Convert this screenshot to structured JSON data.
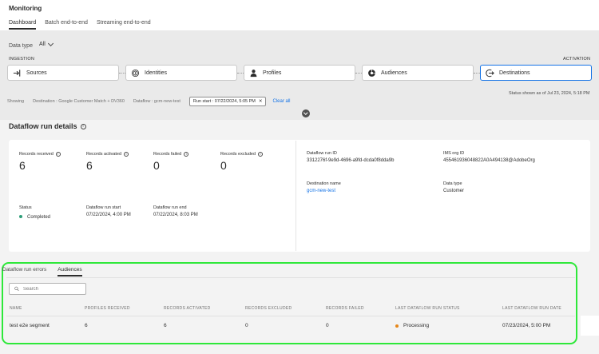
{
  "app": {
    "title": "Monitoring"
  },
  "tabs": [
    {
      "label": "Dashboard",
      "active": true
    },
    {
      "label": "Batch end-to-end",
      "active": false
    },
    {
      "label": "Streaming end-to-end",
      "active": false
    }
  ],
  "data_type": {
    "label": "Data type",
    "value": "All"
  },
  "pipeline": {
    "ingestion_label": "INGESTION",
    "activation_label": "ACTIVATION",
    "steps": [
      {
        "label": "Sources",
        "icon": "sources-icon"
      },
      {
        "label": "Identities",
        "icon": "fingerprint-icon"
      },
      {
        "label": "Profiles",
        "icon": "user-icon"
      },
      {
        "label": "Audiences",
        "icon": "audiences-icon"
      },
      {
        "label": "Destinations",
        "icon": "destinations-icon",
        "active": true
      }
    ]
  },
  "filters": {
    "showing": "Showing",
    "destination": "Destination : Google Customer Match + DV360",
    "dataflow": "Dataflow : gcm-new-test",
    "run_start": "Run start : 07/22/2024, 5:05 PM",
    "clear_all": "Clear all",
    "status_shown": "Status shown as of Jul 23, 2024, 5:18 PM"
  },
  "details": {
    "title": "Dataflow run details",
    "stats": [
      {
        "label": "Records received",
        "value": "6"
      },
      {
        "label": "Records activated",
        "value": "6"
      },
      {
        "label": "Records failed",
        "value": "0"
      },
      {
        "label": "Records excluded",
        "value": "0"
      }
    ],
    "status_label": "Status",
    "status_value": "Completed",
    "status_color": "#2d9d78",
    "run_start_label": "Dataflow run start",
    "run_start_value": "07/22/2024, 4:00 PM",
    "run_end_label": "Dataflow run end",
    "run_end_value": "07/22/2024, 8:03 PM",
    "run_id_label": "Dataflow run ID",
    "run_id_value": "3312276f-9e9d-4696-a9fd-dcda0f8dda9b",
    "ims_label": "IMS org ID",
    "ims_value": "455461936048822A0A494138@AdobeOrg",
    "dest_name_label": "Destination name",
    "dest_name_value": "gcm-new-test",
    "data_type_label": "Data type",
    "data_type_value": "Customer"
  },
  "sub_tabs": [
    {
      "label": "Dataflow run errors",
      "active": false
    },
    {
      "label": "Audiences",
      "active": true
    }
  ],
  "search": {
    "placeholder": "Search"
  },
  "table": {
    "headers": [
      "NAME",
      "PROFILES RECEIVED",
      "RECORDS ACTIVATED",
      "RECORDS EXCLUDED",
      "RECORDS FAILED",
      "LAST DATAFLOW RUN STATUS",
      "LAST DATAFLOW RUN DATE"
    ],
    "rows": [
      {
        "name": "test e2e segment",
        "profiles_received": "6",
        "records_activated": "6",
        "records_excluded": "0",
        "records_failed": "0",
        "status": "Processing",
        "status_color": "#e68619",
        "date": "07/23/2024, 5:00 PM"
      }
    ]
  }
}
